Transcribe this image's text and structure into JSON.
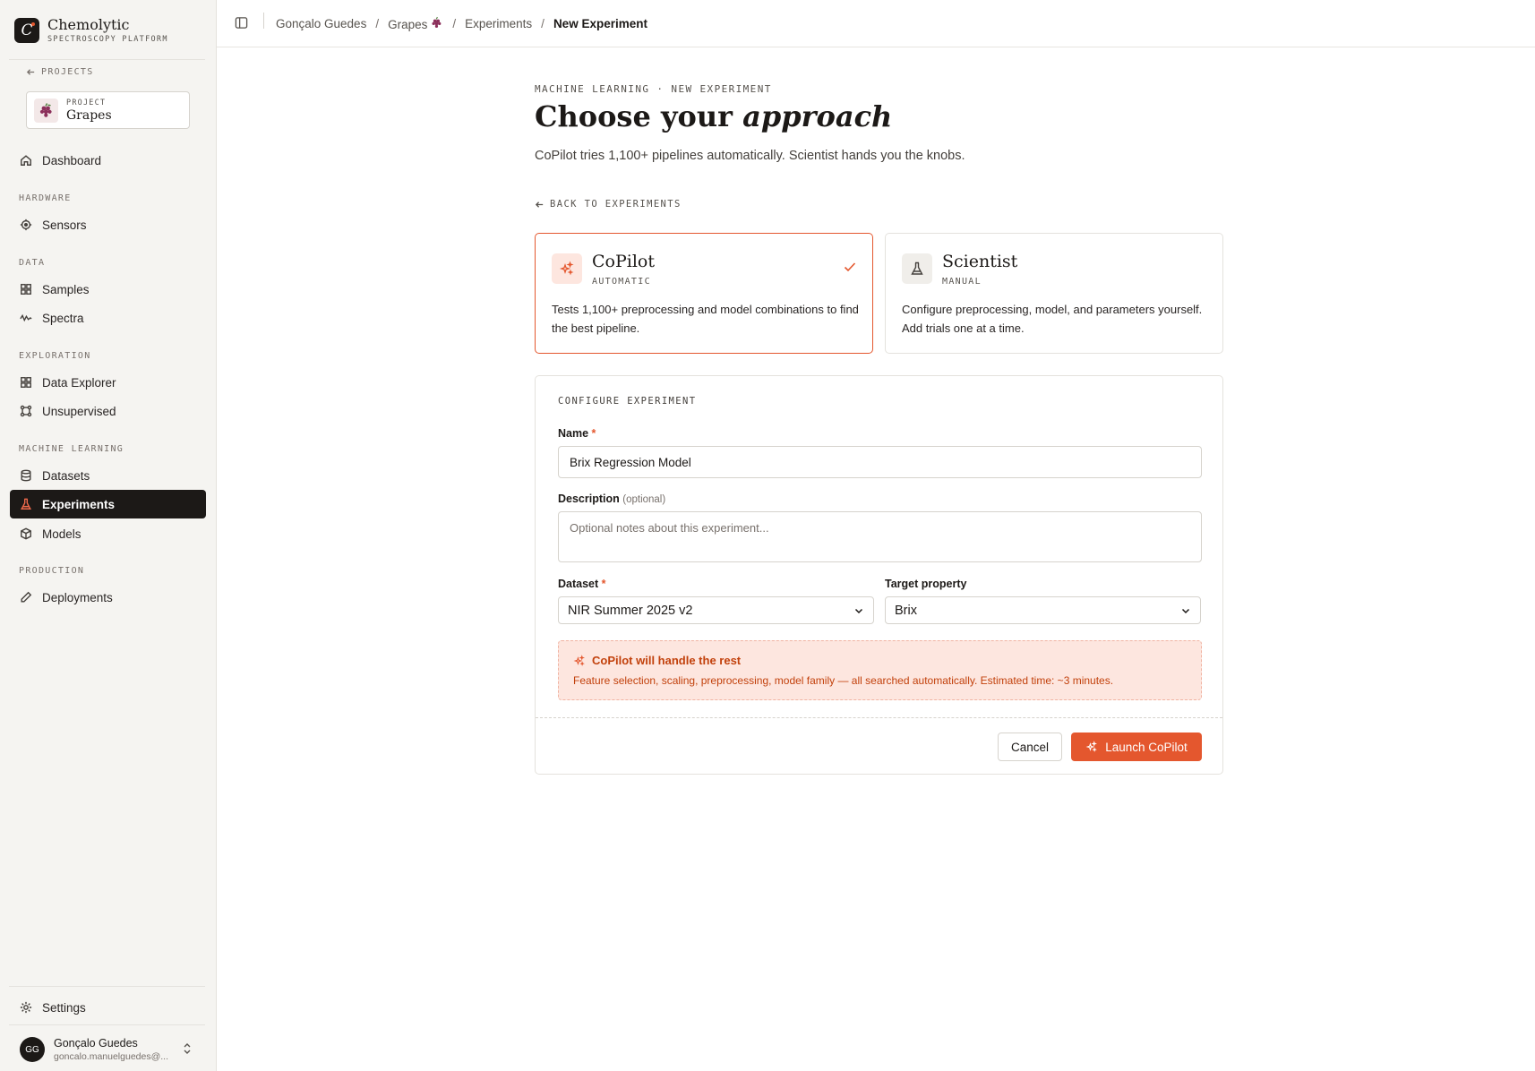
{
  "brand": {
    "name": "Chemolytic",
    "subtitle": "SPECTROSCOPY PLATFORM"
  },
  "sidebar": {
    "back_label": "PROJECTS",
    "project": {
      "label": "PROJECT",
      "name": "Grapes"
    },
    "dashboard": "Dashboard",
    "sections": {
      "hardware": "HARDWARE",
      "data": "DATA",
      "exploration": "EXPLORATION",
      "machine_learning": "MACHINE LEARNING",
      "production": "PRODUCTION"
    },
    "items": {
      "sensors": "Sensors",
      "samples": "Samples",
      "spectra": "Spectra",
      "data_explorer": "Data Explorer",
      "unsupervised": "Unsupervised",
      "datasets": "Datasets",
      "experiments": "Experiments",
      "models": "Models",
      "deployments": "Deployments"
    },
    "active_item": "Experiments",
    "settings": "Settings",
    "user": {
      "initials": "GG",
      "name": "Gonçalo Guedes",
      "email": "goncalo.manuelguedes@..."
    }
  },
  "breadcrumb": [
    "Gonçalo Guedes",
    "Grapes",
    "Experiments",
    "New Experiment"
  ],
  "main": {
    "eyebrow": "MACHINE LEARNING · NEW EXPERIMENT",
    "title_plain": "Choose your",
    "title_italic": "approach",
    "subtitle": "CoPilot tries 1,100+ pipelines automatically. Scientist hands you the knobs.",
    "back_label": "BACK TO EXPERIMENTS",
    "modes": {
      "copilot": {
        "name": "CoPilot",
        "sub": "AUTOMATIC",
        "desc": "Tests 1,100+ preprocessing and model combinations to find the best pipeline.",
        "selected": true
      },
      "scientist": {
        "name": "Scientist",
        "sub": "MANUAL",
        "desc": "Configure preprocessing, model, and parameters yourself. Add trials one at a time.",
        "selected": false
      }
    },
    "config": {
      "title": "CONFIGURE EXPERIMENT",
      "name_label": "Name",
      "name_value": "Brix Regression Model",
      "description_label": "Description",
      "description_optional": "(optional)",
      "description_placeholder": "Optional notes about this experiment...",
      "dataset_label": "Dataset",
      "dataset_value": "NIR Summer 2025 v2",
      "target_label": "Target property",
      "target_value": "Brix",
      "callout_title": "CoPilot will handle the rest",
      "callout_body": "Feature selection, scaling, preprocessing, model family — all searched automatically. Estimated time: ~3 minutes.",
      "cancel_label": "Cancel",
      "launch_label": "Launch CoPilot"
    }
  },
  "colors": {
    "accent": "#e4572e",
    "sidebar_bg": "#f5f4f1",
    "active_bg": "#1c1917",
    "callout_bg": "#fde6df"
  }
}
